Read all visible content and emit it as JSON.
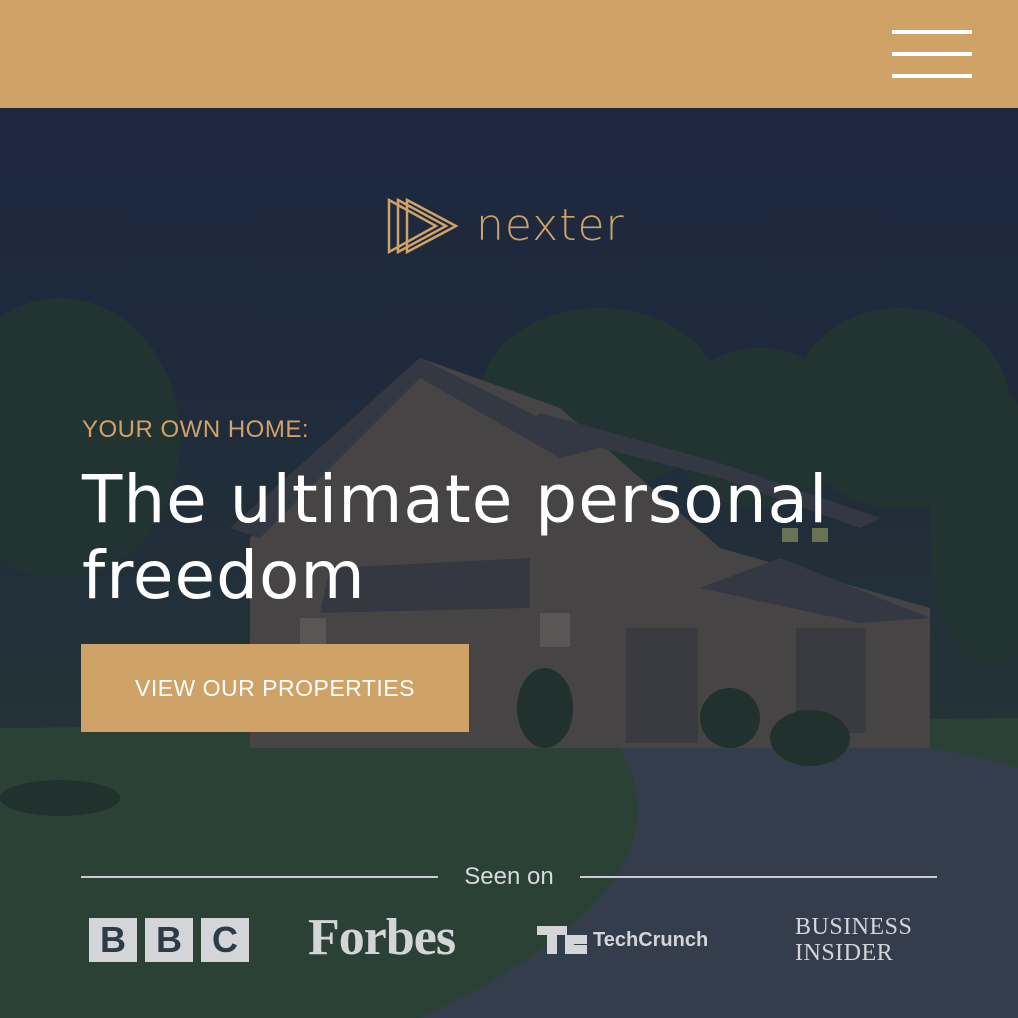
{
  "header": {
    "menu_icon": "hamburger-menu-icon",
    "accent_color": "#cfa267"
  },
  "hero": {
    "logo": {
      "text": "nexter",
      "icon": "triple-triangle-logo-icon"
    },
    "eyebrow": "YOUR OWN HOME:",
    "headline": "The ultimate personal freedom",
    "cta_label": "VIEW OUR PROPERTIES",
    "seen_on_label": "Seen on",
    "press_logos": {
      "bbc": [
        "B",
        "B",
        "C"
      ],
      "forbes": "Forbes",
      "techcrunch": "TechCrunch",
      "business_insider_line1": "BUSINESS",
      "business_insider_line2": "INSIDER"
    }
  }
}
